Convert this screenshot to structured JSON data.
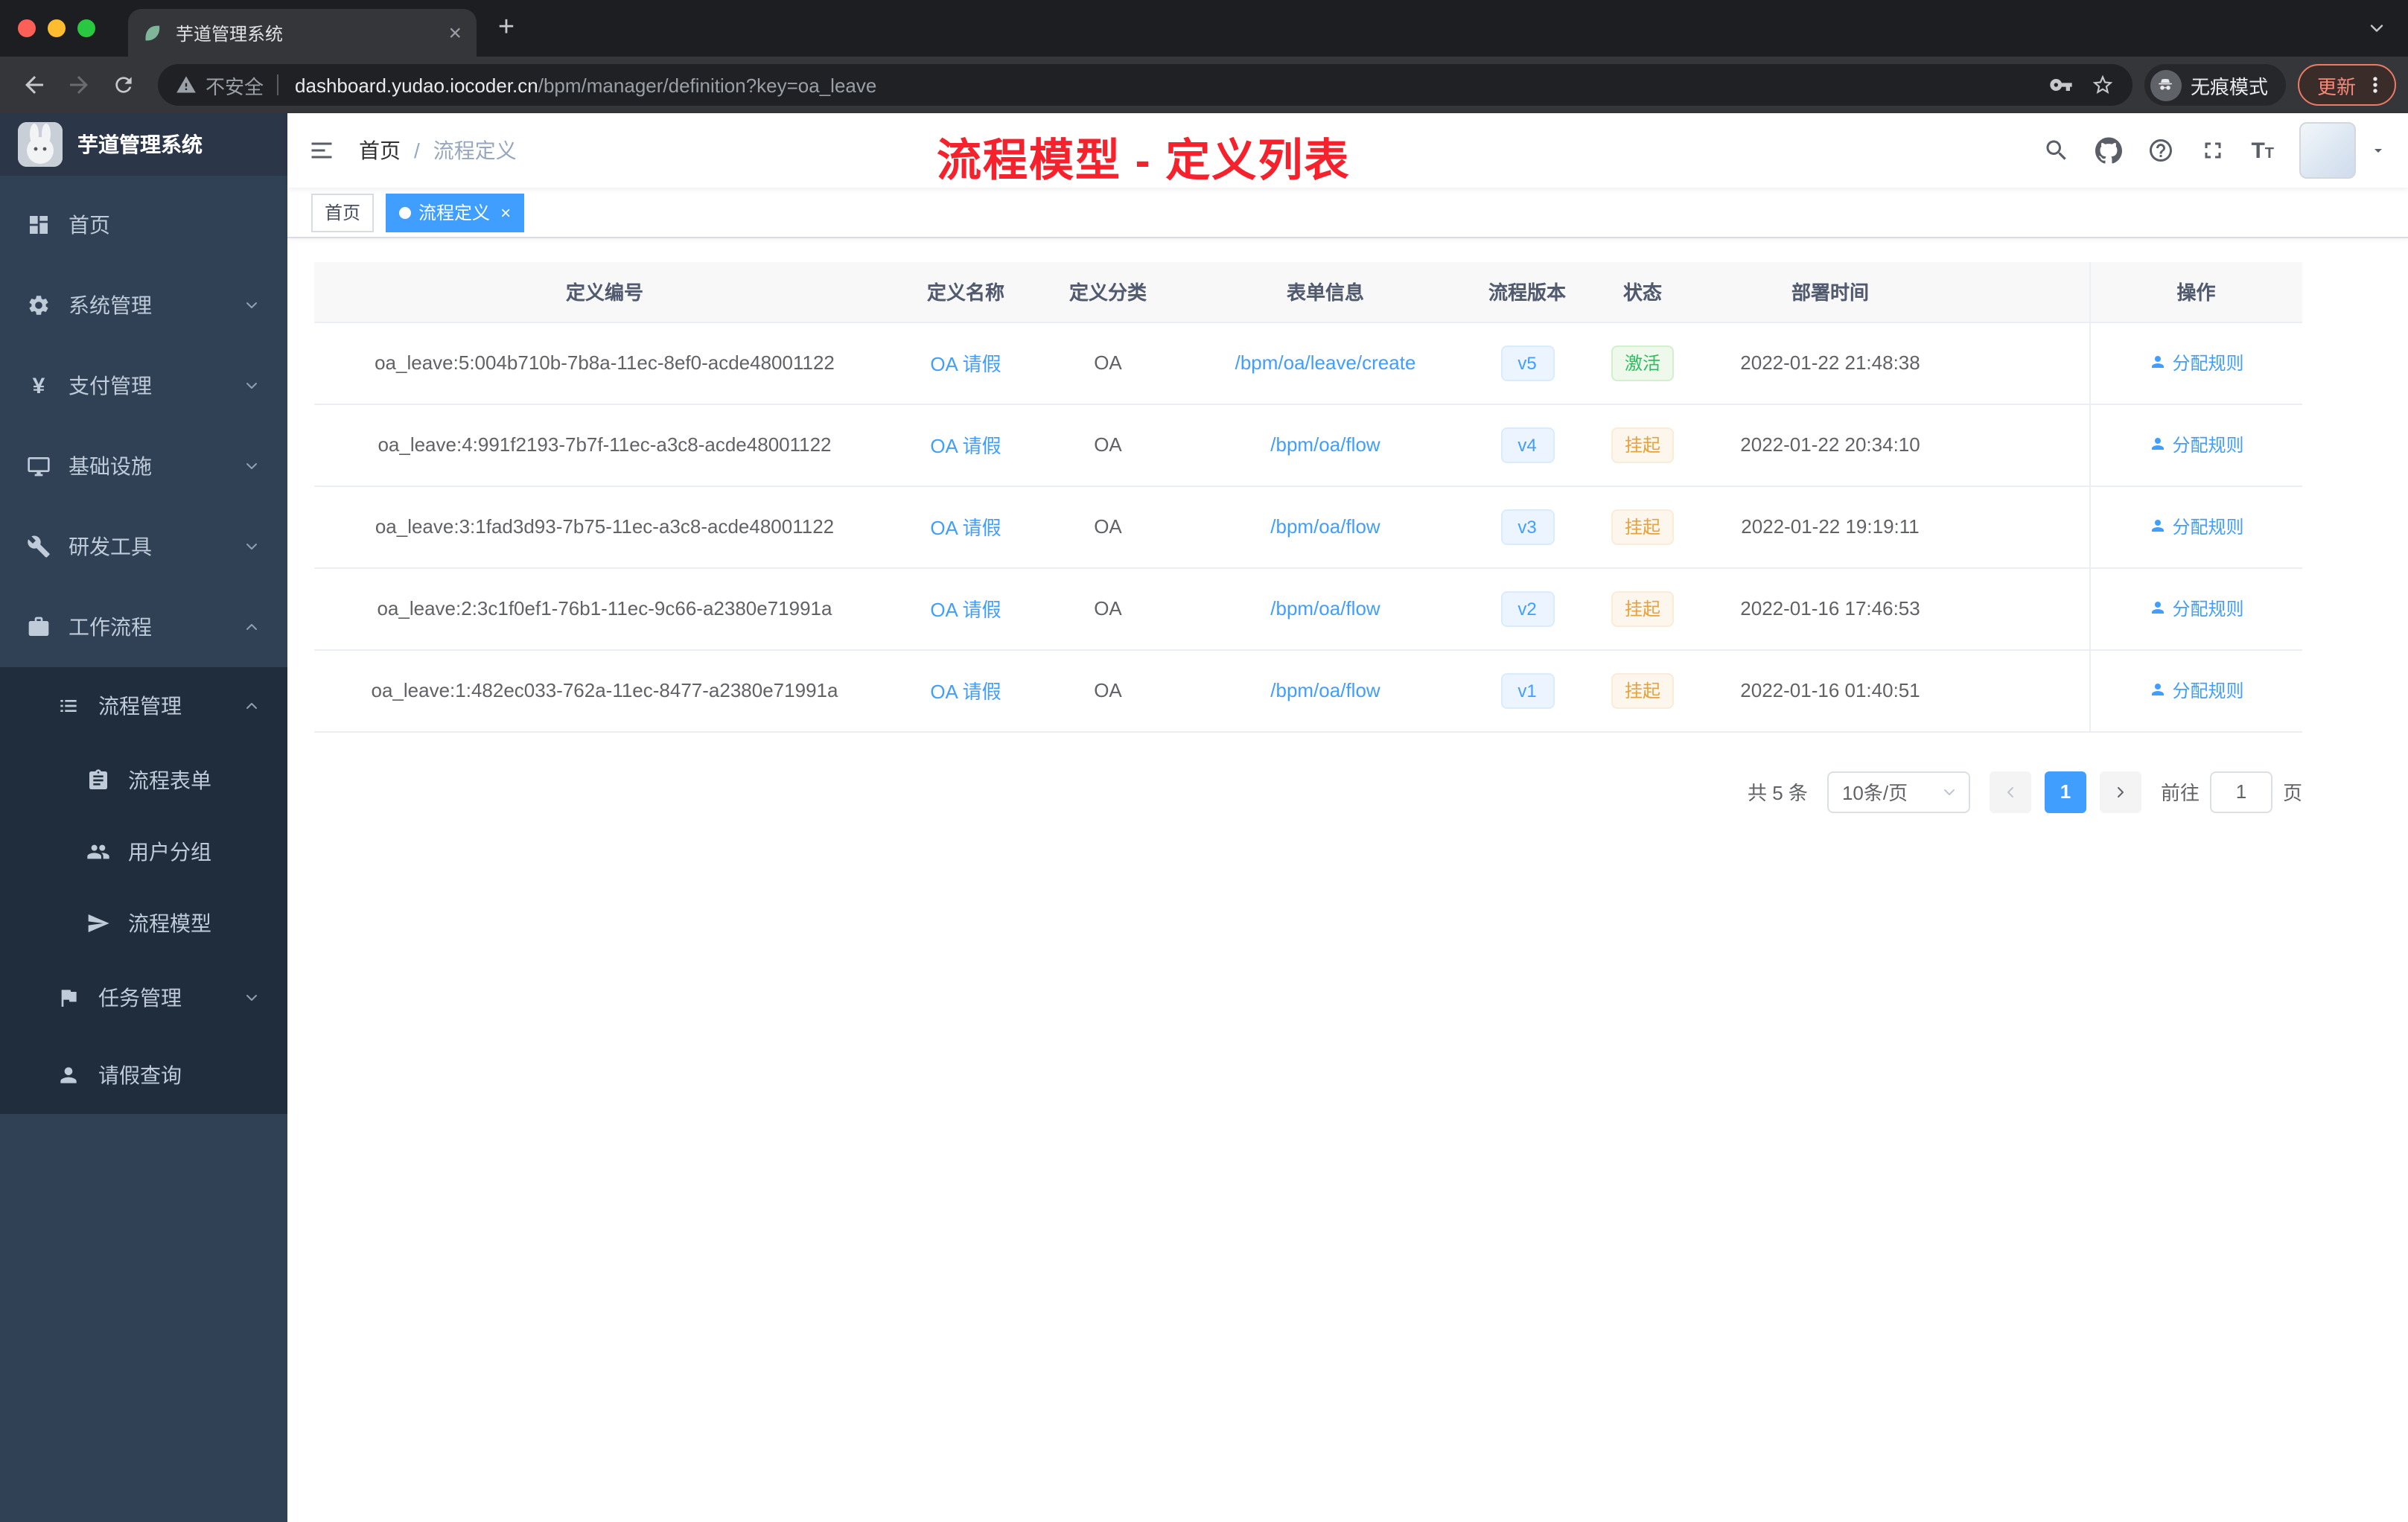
{
  "colors": {
    "accent": "#409eff",
    "success": "#67c23a",
    "warning": "#e6a23c",
    "sidebar_bg": "#304156",
    "sidebar_submenu_bg": "#1f2d3d",
    "annotation_red": "#f5222d",
    "version_tag": "#409eff"
  },
  "browser": {
    "tab_title": "芋道管理系统",
    "not_secure": "不安全",
    "url_domain": "dashboard.yudao.iocoder.cn",
    "url_path": "/bpm/manager/definition?key=oa_leave",
    "incognito_label": "无痕模式",
    "update_label": "更新"
  },
  "sidebar": {
    "logo_title": "芋道管理系统",
    "items": [
      {
        "label": "首页"
      },
      {
        "label": "系统管理"
      },
      {
        "label": "支付管理"
      },
      {
        "label": "基础设施"
      },
      {
        "label": "研发工具"
      },
      {
        "label": "工作流程"
      },
      {
        "label": "流程管理"
      },
      {
        "label": "流程表单"
      },
      {
        "label": "用户分组"
      },
      {
        "label": "流程模型"
      },
      {
        "label": "任务管理"
      },
      {
        "label": "请假查询"
      }
    ]
  },
  "header": {
    "breadcrumb": [
      "首页",
      "流程定义"
    ],
    "breadcrumb_separator": "/",
    "annotation": "流程模型 - 定义列表"
  },
  "tags": [
    {
      "label": "首页"
    },
    {
      "label": "流程定义"
    }
  ],
  "table": {
    "columns": [
      "定义编号",
      "定义名称",
      "定义分类",
      "表单信息",
      "流程版本",
      "状态",
      "部署时间",
      "操作"
    ],
    "action_label": "分配规则",
    "rows": [
      {
        "id": "oa_leave:5:004b710b-7b8a-11ec-8ef0-acde48001122",
        "name": "OA 请假",
        "category": "OA",
        "form": "/bpm/oa/leave/create",
        "version": "v5",
        "status": "激活",
        "status_type": "success",
        "time": "2022-01-22 21:48:38"
      },
      {
        "id": "oa_leave:4:991f2193-7b7f-11ec-a3c8-acde48001122",
        "name": "OA 请假",
        "category": "OA",
        "form": "/bpm/oa/flow",
        "version": "v4",
        "status": "挂起",
        "status_type": "warning",
        "time": "2022-01-22 20:34:10"
      },
      {
        "id": "oa_leave:3:1fad3d93-7b75-11ec-a3c8-acde48001122",
        "name": "OA 请假",
        "category": "OA",
        "form": "/bpm/oa/flow",
        "version": "v3",
        "status": "挂起",
        "status_type": "warning",
        "time": "2022-01-22 19:19:11"
      },
      {
        "id": "oa_leave:2:3c1f0ef1-76b1-11ec-9c66-a2380e71991a",
        "name": "OA 请假",
        "category": "OA",
        "form": "/bpm/oa/flow",
        "version": "v2",
        "status": "挂起",
        "status_type": "warning",
        "time": "2022-01-16 17:46:53"
      },
      {
        "id": "oa_leave:1:482ec033-762a-11ec-8477-a2380e71991a",
        "name": "OA 请假",
        "category": "OA",
        "form": "/bpm/oa/flow",
        "version": "v1",
        "status": "挂起",
        "status_type": "warning",
        "time": "2022-01-16 01:40:51"
      }
    ]
  },
  "pagination": {
    "total": "共 5 条",
    "page_size": "10条/页",
    "page": "1",
    "goto_label": "前往",
    "goto_value": "1",
    "page_unit": "页"
  }
}
